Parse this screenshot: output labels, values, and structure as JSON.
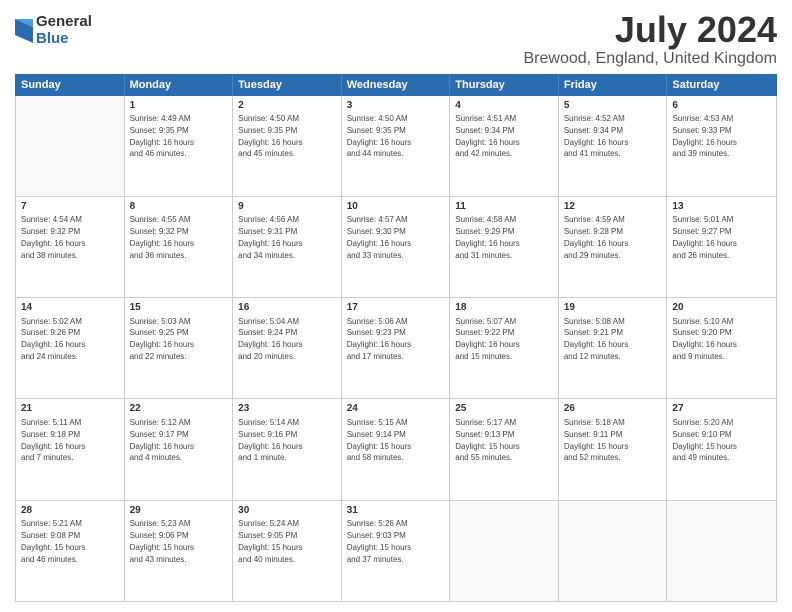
{
  "logo": {
    "general": "General",
    "blue": "Blue"
  },
  "title": "July 2024",
  "subtitle": "Brewood, England, United Kingdom",
  "days": [
    "Sunday",
    "Monday",
    "Tuesday",
    "Wednesday",
    "Thursday",
    "Friday",
    "Saturday"
  ],
  "rows": [
    [
      {
        "day": "",
        "text": "",
        "empty": true
      },
      {
        "day": "1",
        "text": "Sunrise: 4:49 AM\nSunset: 9:35 PM\nDaylight: 16 hours\nand 46 minutes.",
        "empty": false
      },
      {
        "day": "2",
        "text": "Sunrise: 4:50 AM\nSunset: 9:35 PM\nDaylight: 16 hours\nand 45 minutes.",
        "empty": false
      },
      {
        "day": "3",
        "text": "Sunrise: 4:50 AM\nSunset: 9:35 PM\nDaylight: 16 hours\nand 44 minutes.",
        "empty": false
      },
      {
        "day": "4",
        "text": "Sunrise: 4:51 AM\nSunset: 9:34 PM\nDaylight: 16 hours\nand 42 minutes.",
        "empty": false
      },
      {
        "day": "5",
        "text": "Sunrise: 4:52 AM\nSunset: 9:34 PM\nDaylight: 16 hours\nand 41 minutes.",
        "empty": false
      },
      {
        "day": "6",
        "text": "Sunrise: 4:53 AM\nSunset: 9:33 PM\nDaylight: 16 hours\nand 39 minutes.",
        "empty": false
      }
    ],
    [
      {
        "day": "7",
        "text": "Sunrise: 4:54 AM\nSunset: 9:32 PM\nDaylight: 16 hours\nand 38 minutes.",
        "empty": false
      },
      {
        "day": "8",
        "text": "Sunrise: 4:55 AM\nSunset: 9:32 PM\nDaylight: 16 hours\nand 36 minutes.",
        "empty": false
      },
      {
        "day": "9",
        "text": "Sunrise: 4:56 AM\nSunset: 9:31 PM\nDaylight: 16 hours\nand 34 minutes.",
        "empty": false
      },
      {
        "day": "10",
        "text": "Sunrise: 4:57 AM\nSunset: 9:30 PM\nDaylight: 16 hours\nand 33 minutes.",
        "empty": false
      },
      {
        "day": "11",
        "text": "Sunrise: 4:58 AM\nSunset: 9:29 PM\nDaylight: 16 hours\nand 31 minutes.",
        "empty": false
      },
      {
        "day": "12",
        "text": "Sunrise: 4:59 AM\nSunset: 9:28 PM\nDaylight: 16 hours\nand 29 minutes.",
        "empty": false
      },
      {
        "day": "13",
        "text": "Sunrise: 5:01 AM\nSunset: 9:27 PM\nDaylight: 16 hours\nand 26 minutes.",
        "empty": false
      }
    ],
    [
      {
        "day": "14",
        "text": "Sunrise: 5:02 AM\nSunset: 9:26 PM\nDaylight: 16 hours\nand 24 minutes.",
        "empty": false
      },
      {
        "day": "15",
        "text": "Sunrise: 5:03 AM\nSunset: 9:25 PM\nDaylight: 16 hours\nand 22 minutes.",
        "empty": false
      },
      {
        "day": "16",
        "text": "Sunrise: 5:04 AM\nSunset: 9:24 PM\nDaylight: 16 hours\nand 20 minutes.",
        "empty": false
      },
      {
        "day": "17",
        "text": "Sunrise: 5:06 AM\nSunset: 9:23 PM\nDaylight: 16 hours\nand 17 minutes.",
        "empty": false
      },
      {
        "day": "18",
        "text": "Sunrise: 5:07 AM\nSunset: 9:22 PM\nDaylight: 16 hours\nand 15 minutes.",
        "empty": false
      },
      {
        "day": "19",
        "text": "Sunrise: 5:08 AM\nSunset: 9:21 PM\nDaylight: 16 hours\nand 12 minutes.",
        "empty": false
      },
      {
        "day": "20",
        "text": "Sunrise: 5:10 AM\nSunset: 9:20 PM\nDaylight: 16 hours\nand 9 minutes.",
        "empty": false
      }
    ],
    [
      {
        "day": "21",
        "text": "Sunrise: 5:11 AM\nSunset: 9:18 PM\nDaylight: 16 hours\nand 7 minutes.",
        "empty": false
      },
      {
        "day": "22",
        "text": "Sunrise: 5:12 AM\nSunset: 9:17 PM\nDaylight: 16 hours\nand 4 minutes.",
        "empty": false
      },
      {
        "day": "23",
        "text": "Sunrise: 5:14 AM\nSunset: 9:16 PM\nDaylight: 16 hours\nand 1 minute.",
        "empty": false
      },
      {
        "day": "24",
        "text": "Sunrise: 5:15 AM\nSunset: 9:14 PM\nDaylight: 15 hours\nand 58 minutes.",
        "empty": false
      },
      {
        "day": "25",
        "text": "Sunrise: 5:17 AM\nSunset: 9:13 PM\nDaylight: 15 hours\nand 55 minutes.",
        "empty": false
      },
      {
        "day": "26",
        "text": "Sunrise: 5:18 AM\nSunset: 9:11 PM\nDaylight: 15 hours\nand 52 minutes.",
        "empty": false
      },
      {
        "day": "27",
        "text": "Sunrise: 5:20 AM\nSunset: 9:10 PM\nDaylight: 15 hours\nand 49 minutes.",
        "empty": false
      }
    ],
    [
      {
        "day": "28",
        "text": "Sunrise: 5:21 AM\nSunset: 9:08 PM\nDaylight: 15 hours\nand 46 minutes.",
        "empty": false
      },
      {
        "day": "29",
        "text": "Sunrise: 5:23 AM\nSunset: 9:06 PM\nDaylight: 15 hours\nand 43 minutes.",
        "empty": false
      },
      {
        "day": "30",
        "text": "Sunrise: 5:24 AM\nSunset: 9:05 PM\nDaylight: 15 hours\nand 40 minutes.",
        "empty": false
      },
      {
        "day": "31",
        "text": "Sunrise: 5:26 AM\nSunset: 9:03 PM\nDaylight: 15 hours\nand 37 minutes.",
        "empty": false
      },
      {
        "day": "",
        "text": "",
        "empty": true
      },
      {
        "day": "",
        "text": "",
        "empty": true
      },
      {
        "day": "",
        "text": "",
        "empty": true
      }
    ]
  ]
}
